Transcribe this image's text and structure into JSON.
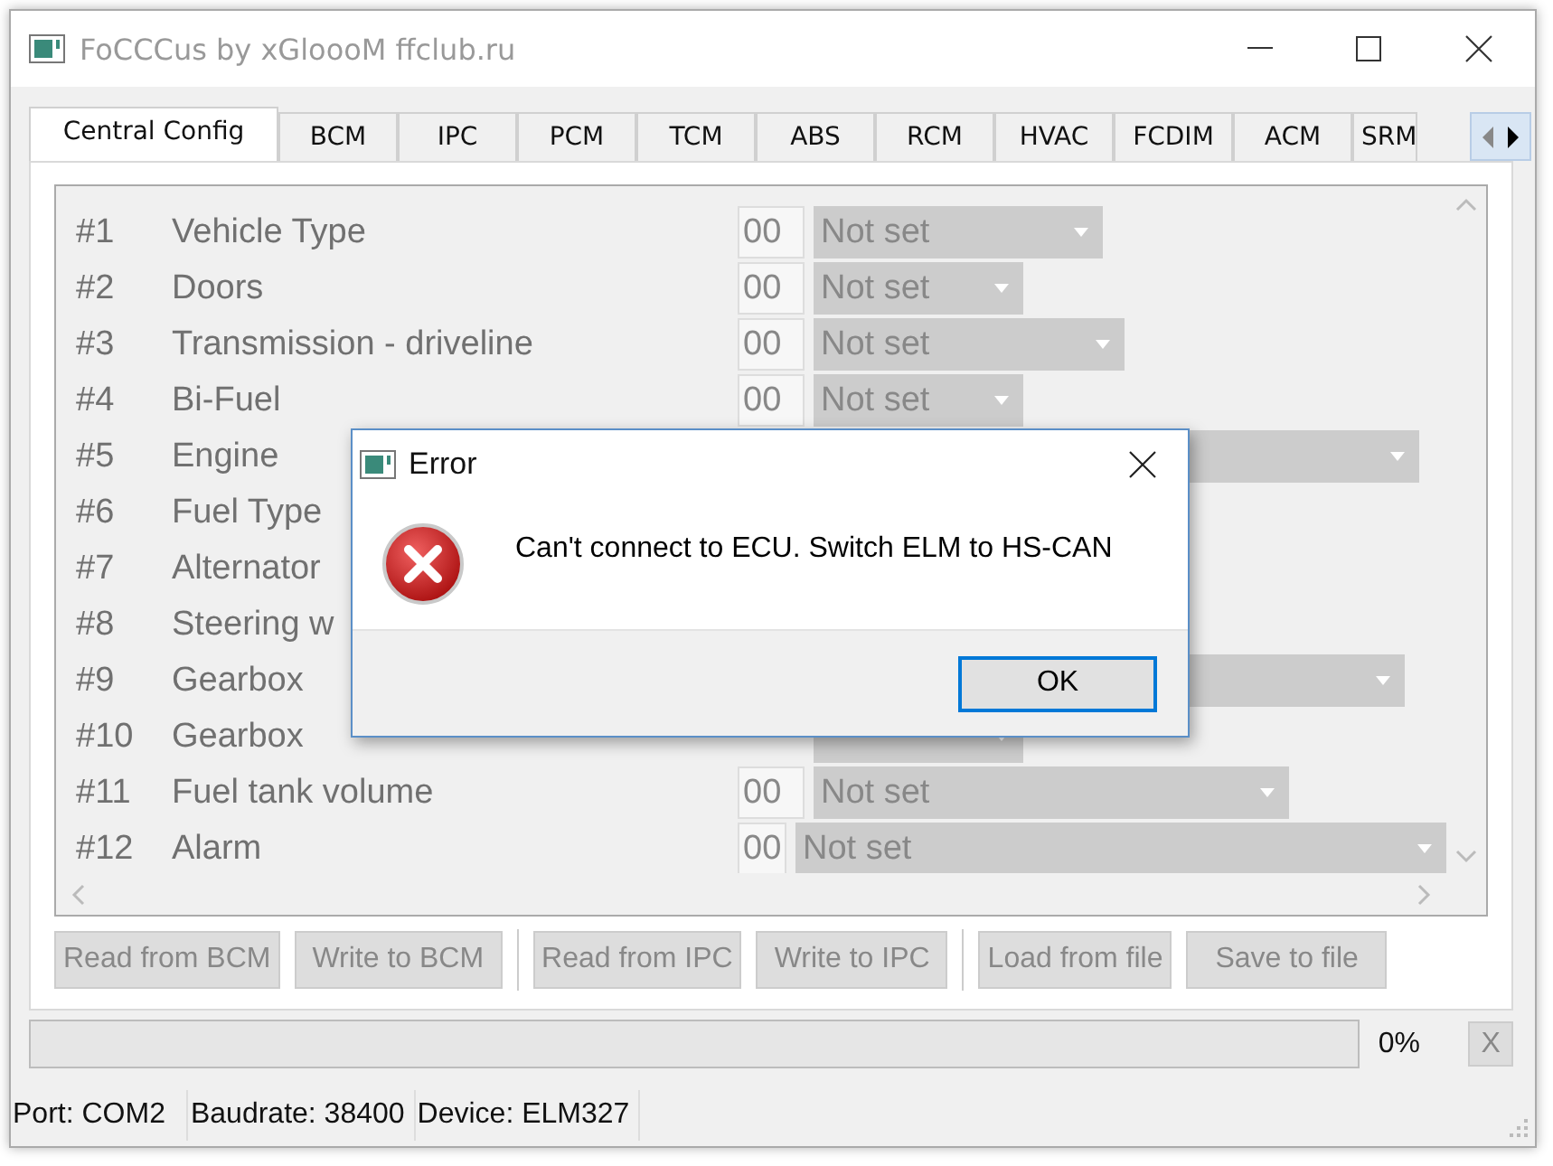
{
  "window": {
    "title": "FoCCCus by xGloooM ffclub.ru",
    "active": false
  },
  "tabs": [
    {
      "label": "Central Config",
      "selected": true
    },
    {
      "label": "BCM",
      "selected": false
    },
    {
      "label": "IPC",
      "selected": false
    },
    {
      "label": "PCM",
      "selected": false
    },
    {
      "label": "TCM",
      "selected": false
    },
    {
      "label": "ABS",
      "selected": false
    },
    {
      "label": "RCM",
      "selected": false
    },
    {
      "label": "HVAC",
      "selected": false
    },
    {
      "label": "FCDIM",
      "selected": false
    },
    {
      "label": "ACM",
      "selected": false
    },
    {
      "label": "SRM",
      "selected": false
    }
  ],
  "config_rows": [
    {
      "number": "#1",
      "label": "Vehicle Type",
      "code": "00",
      "value": "Not set",
      "kind": "dropdown",
      "disabled": true
    },
    {
      "number": "#2",
      "label": "Doors",
      "code": "00",
      "value": "Not set",
      "kind": "dropdown",
      "disabled": true
    },
    {
      "number": "#3",
      "label": "Transmission - driveline",
      "code": "00",
      "value": "Not set",
      "kind": "dropdown",
      "disabled": true
    },
    {
      "number": "#4",
      "label": "Bi-Fuel",
      "code": "00",
      "value": "Not set",
      "kind": "dropdown",
      "disabled": true
    },
    {
      "number": "#5",
      "label": "Engine",
      "kind": "dropdown",
      "disabled": true
    },
    {
      "number": "#6",
      "label": "Fuel Type",
      "kind": "label",
      "disabled": true
    },
    {
      "number": "#7",
      "label": "Alternator",
      "kind": "label",
      "disabled": true
    },
    {
      "number": "#8",
      "label": "Steering w",
      "kind": "label",
      "disabled": true
    },
    {
      "number": "#9",
      "label": "Gearbox",
      "kind": "dropdown",
      "disabled": true
    },
    {
      "number": "#10",
      "label": "Gearbox",
      "kind": "dropdown",
      "disabled": true
    },
    {
      "number": "#11",
      "label": "Fuel tank volume",
      "code": "00",
      "value": "Not set",
      "kind": "dropdown",
      "disabled": true
    },
    {
      "number": "#12",
      "label": "Alarm",
      "code": "00",
      "value": "Not set",
      "kind": "dropdown",
      "disabled": true
    }
  ],
  "button_groups": [
    [
      {
        "label": "Read from BCM",
        "disabled": true
      },
      {
        "label": "Write to BCM",
        "disabled": true
      }
    ],
    [
      {
        "label": "Read from IPC",
        "disabled": true
      },
      {
        "label": "Write to IPC",
        "disabled": true
      }
    ],
    [
      {
        "label": "Load from file",
        "disabled": true
      },
      {
        "label": "Save to file",
        "disabled": true
      }
    ]
  ],
  "progress": {
    "level": 0,
    "reading": "0%"
  },
  "cancel_button": {
    "label": "X",
    "disabled": true
  },
  "status_bar": [
    "Port: COM2",
    "Baudrate: 38400",
    "Device: ELM327"
  ],
  "dialog": {
    "title": "Error",
    "active": true,
    "message": "Can't connect to ECU. Switch ELM to HS-CAN",
    "buttons": [
      {
        "label": "OK",
        "default": true
      }
    ]
  }
}
